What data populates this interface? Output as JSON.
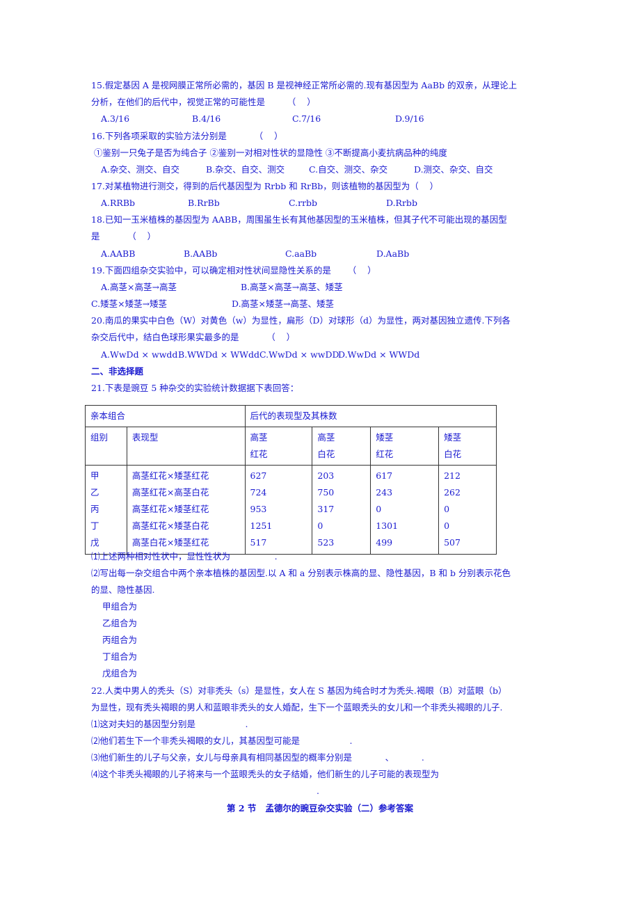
{
  "q15": {
    "line1": "15.假定基因 A 是视网膜正常所必需的，基因 B 是视神经正常所必需的.现有基因型为 AaBb 的双亲，从理论上",
    "line2": "分析，在他们的后代中，视觉正常的可能性是        （    ）",
    "options": [
      "A.3/16",
      "B.4/16",
      "C.7/16",
      "D.9/16"
    ]
  },
  "q16": {
    "line1": "16.下列各项采取的实验方法分别是          （    ）",
    "line2": " ①鉴别一只兔子是否为纯合子 ②鉴别一对相对性状的显隐性 ③不断提高小麦抗病品种的纯度",
    "options": [
      "A.杂交、测交、自交",
      "B.杂交、自交、测交",
      "C.自交、测交、杂交",
      "D.测交、杂交、自交"
    ]
  },
  "q17": {
    "line1": "17.对某植物进行测交，得到的后代基因型为 Rrbb 和 RrBb，则该植物的基因型为（    ）",
    "options": [
      "A.RRBb",
      "B.RrBb",
      "C.rrbb",
      "D.Rrbb"
    ]
  },
  "q18": {
    "line1": "18.已知一玉米植株的基因型为 AABB，周围虽生长有其他基因型的玉米植株，但其子代不可能出现的基因型",
    "line2": "是          （    ）",
    "options": [
      "A.AABB",
      "B.AABb",
      "C.aaBb",
      "D.AaBb"
    ]
  },
  "q19": {
    "line1": "19.下面四组杂交实验中，可以确定相对性状间显隐性关系的是      （    ）",
    "options": [
      "A.高茎×高茎→高茎",
      "B.高茎×高茎→高茎、矮茎",
      "C.矮茎×矮茎→矮茎",
      "D.高茎×矮茎→高茎、矮茎"
    ]
  },
  "q20": {
    "line1": "20.南瓜的果实中白色（W）对黄色（w）为显性，扁形（D）对球形（d）为显性，两对基因独立遗传.下列各",
    "line2": "杂交后代中，结白色球形果实最多的是          （    ）",
    "options": [
      "A.WwDd × wwdd",
      "B.WWDd × WWdd",
      "C.WwDd × wwDD",
      "D.WwDd × WWDd"
    ]
  },
  "section2_title": "二、非选择题",
  "q21": {
    "intro": "21.下表是豌豆 5 种杂交的实验统计数据据下表回答：",
    "table": {
      "header_parent": "亲本组合",
      "header_offspring": "后代的表现型及其株数",
      "col_group": "组别",
      "col_phenotype": "表现型",
      "col_offspring": [
        {
          "line1": "高茎",
          "line2": "红花"
        },
        {
          "line1": "高茎",
          "line2": "白花"
        },
        {
          "line1": "矮茎",
          "line2": "红花"
        },
        {
          "line1": "矮茎",
          "line2": "白花"
        }
      ],
      "rows": [
        {
          "group": "甲",
          "phenotype": "高茎红花×矮茎红花",
          "values": [
            "627",
            "203",
            "617",
            "212"
          ]
        },
        {
          "group": "乙",
          "phenotype": "高茎红花×高茎白花",
          "values": [
            "724",
            "750",
            "243",
            "262"
          ]
        },
        {
          "group": "丙",
          "phenotype": "高茎红花×矮茎红花",
          "values": [
            "953",
            "317",
            "0",
            "0"
          ]
        },
        {
          "group": "丁",
          "phenotype": "高茎红花×矮茎白花",
          "values": [
            "1251",
            "0",
            "1301",
            "0"
          ]
        },
        {
          "group": "戊",
          "phenotype": "高茎白花×矮茎红花",
          "values": [
            "517",
            "523",
            "499",
            "507"
          ]
        }
      ]
    },
    "sub1": "⑴上述两种相对性状中，显性性状为                .",
    "sub2_line1": "⑵写出每一杂交组合中两个亲本植株的基因型.以 A 和 a 分别表示株高的显、隐性基因，B 和 b 分别表示花色",
    "sub2_line2": "的显、隐性基因.",
    "combos": [
      "甲组合为",
      "乙组合为",
      "丙组合为",
      "丁组合为",
      "戊组合为"
    ]
  },
  "q22": {
    "line1": "22.人类中男人的秃头（S）对非秃头（s）是显性，女人在 S 基因为纯合时才为秃头.褐眼（B）对蓝眼（b）",
    "line2": "为显性，现有秃头褐眼的男人和蓝眼非秃头的女人婚配，生下一个蓝眼秃头的女儿和一个非秃头褐眼的儿子.",
    "sub1": "⑴这对夫妇的基因型分别是                  .",
    "sub2": "⑵他们若生下一个非秃头褐眼的女儿，其基因型可能是                  .",
    "sub3": "⑶他们新生的儿子与父亲，女儿与母亲具有相同基因型的概率分别是            、          .",
    "sub4": "⑷这个非秃头褐眼的儿子将来与一个蓝眼秃头的女子结婚，他们新生的儿子可能的表现型为",
    "sub4_end": "."
  },
  "answer_title": "第 2 节   孟德尔的豌豆杂交实验（二）参考答案"
}
